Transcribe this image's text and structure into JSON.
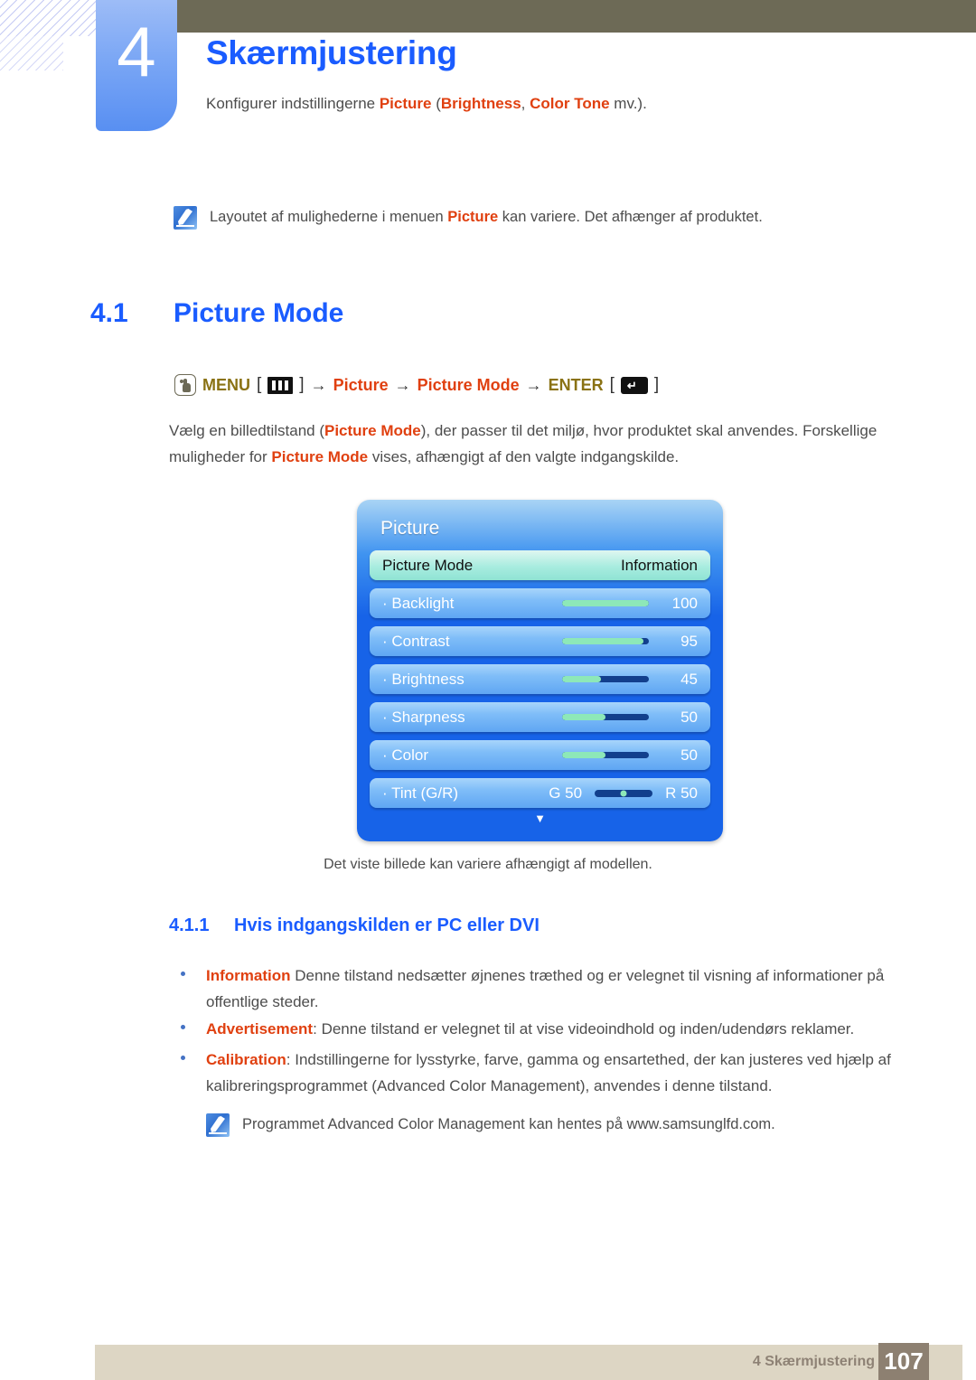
{
  "header": {
    "chapter_number": "4",
    "chapter_title": "Skærmjustering",
    "subtitle_prefix": "Konfigurer indstillingerne ",
    "subtitle_kw1": "Picture",
    "subtitle_mid1": " (",
    "subtitle_kw2": "Brightness",
    "subtitle_mid2": ", ",
    "subtitle_kw3": "Color Tone",
    "subtitle_suffix": " mv.).",
    "hand_icon": "hand-pointer-icon",
    "note_icon": "note-quill-icon"
  },
  "top_note": {
    "icon": "note-quill-icon",
    "text_before": "Layoutet af mulighederne i menuen ",
    "keyword": "Picture",
    "text_after": " kan variere. Det afhænger af produktet."
  },
  "section": {
    "number": "4.1",
    "title": "Picture Mode"
  },
  "menu_path": {
    "hand_icon": "hand-pointer-icon",
    "menu_label": "MENU",
    "bracket_open": "[",
    "menu_glyph": "menu-bars-icon",
    "bracket_close": "]",
    "arrow": "→",
    "step1": "Picture",
    "step2": "Picture Mode",
    "enter_label": "ENTER",
    "enter_glyph": "enter-key-icon"
  },
  "paragraph": {
    "p1": "Vælg en billedtilstand (",
    "kw1": "Picture Mode",
    "p2": "), der passer til det miljø, hvor produktet skal anvendes. Forskellige muligheder for ",
    "kw2": "Picture Mode",
    "p3": " vises, afhængigt af den valgte indgangskilde."
  },
  "osd": {
    "title": "Picture",
    "rows": [
      {
        "name": "picture-mode",
        "label": "Picture Mode",
        "value_text": "Information",
        "type": "select",
        "highlight": true
      },
      {
        "name": "backlight",
        "label": "· Backlight",
        "value": "100",
        "fill_percent": 100,
        "type": "slider"
      },
      {
        "name": "contrast",
        "label": "· Contrast",
        "value": "95",
        "fill_percent": 95,
        "type": "slider"
      },
      {
        "name": "brightness",
        "label": "· Brightness",
        "value": "45",
        "fill_percent": 45,
        "type": "slider"
      },
      {
        "name": "sharpness",
        "label": "· Sharpness",
        "value": "50",
        "fill_percent": 50,
        "type": "slider"
      },
      {
        "name": "color",
        "label": "· Color",
        "value": "50",
        "fill_percent": 50,
        "type": "slider"
      },
      {
        "name": "tint",
        "label": "· Tint (G/R)",
        "value_left": "G 50",
        "value_right": "R 50",
        "type": "tint"
      }
    ],
    "scroll_caret": "▼",
    "caption": "Det viste billede kan variere afhængigt af modellen."
  },
  "subsection": {
    "number": "4.1.1",
    "title": "Hvis indgangskilden er PC eller DVI"
  },
  "bullets": [
    {
      "keyword": "Information",
      "separator": " ",
      "text": "Denne tilstand nedsætter øjnenes træthed og er velegnet til visning af informationer på offentlige steder."
    },
    {
      "keyword": "Advertisement",
      "separator": ": ",
      "text": "Denne tilstand er velegnet til at vise videoindhold og inden/udendørs reklamer."
    },
    {
      "keyword": "Calibration",
      "separator": ": ",
      "text": "Indstillingerne for lysstyrke, farve, gamma og ensartethed, der kan justeres ved hjælp af kalibreringsprogrammet (Advanced Color Management), anvendes i denne tilstand."
    }
  ],
  "bottom_note": {
    "icon": "note-quill-icon",
    "text": "Programmet Advanced Color Management kan hentes på www.samsunglfd.com."
  },
  "footer": {
    "label": "4 Skærmjustering",
    "page": "107"
  },
  "colors": {
    "accent_blue": "#1a5cff",
    "keyword_red": "#e04010",
    "olive": "#6d6a56",
    "menu_olive_text": "#8a7214",
    "footer_bar": "#ddd6c4",
    "footer_page_box": "#8d8071",
    "osd_blue": "#1763e8",
    "slider_fill": "#8de8b8"
  }
}
